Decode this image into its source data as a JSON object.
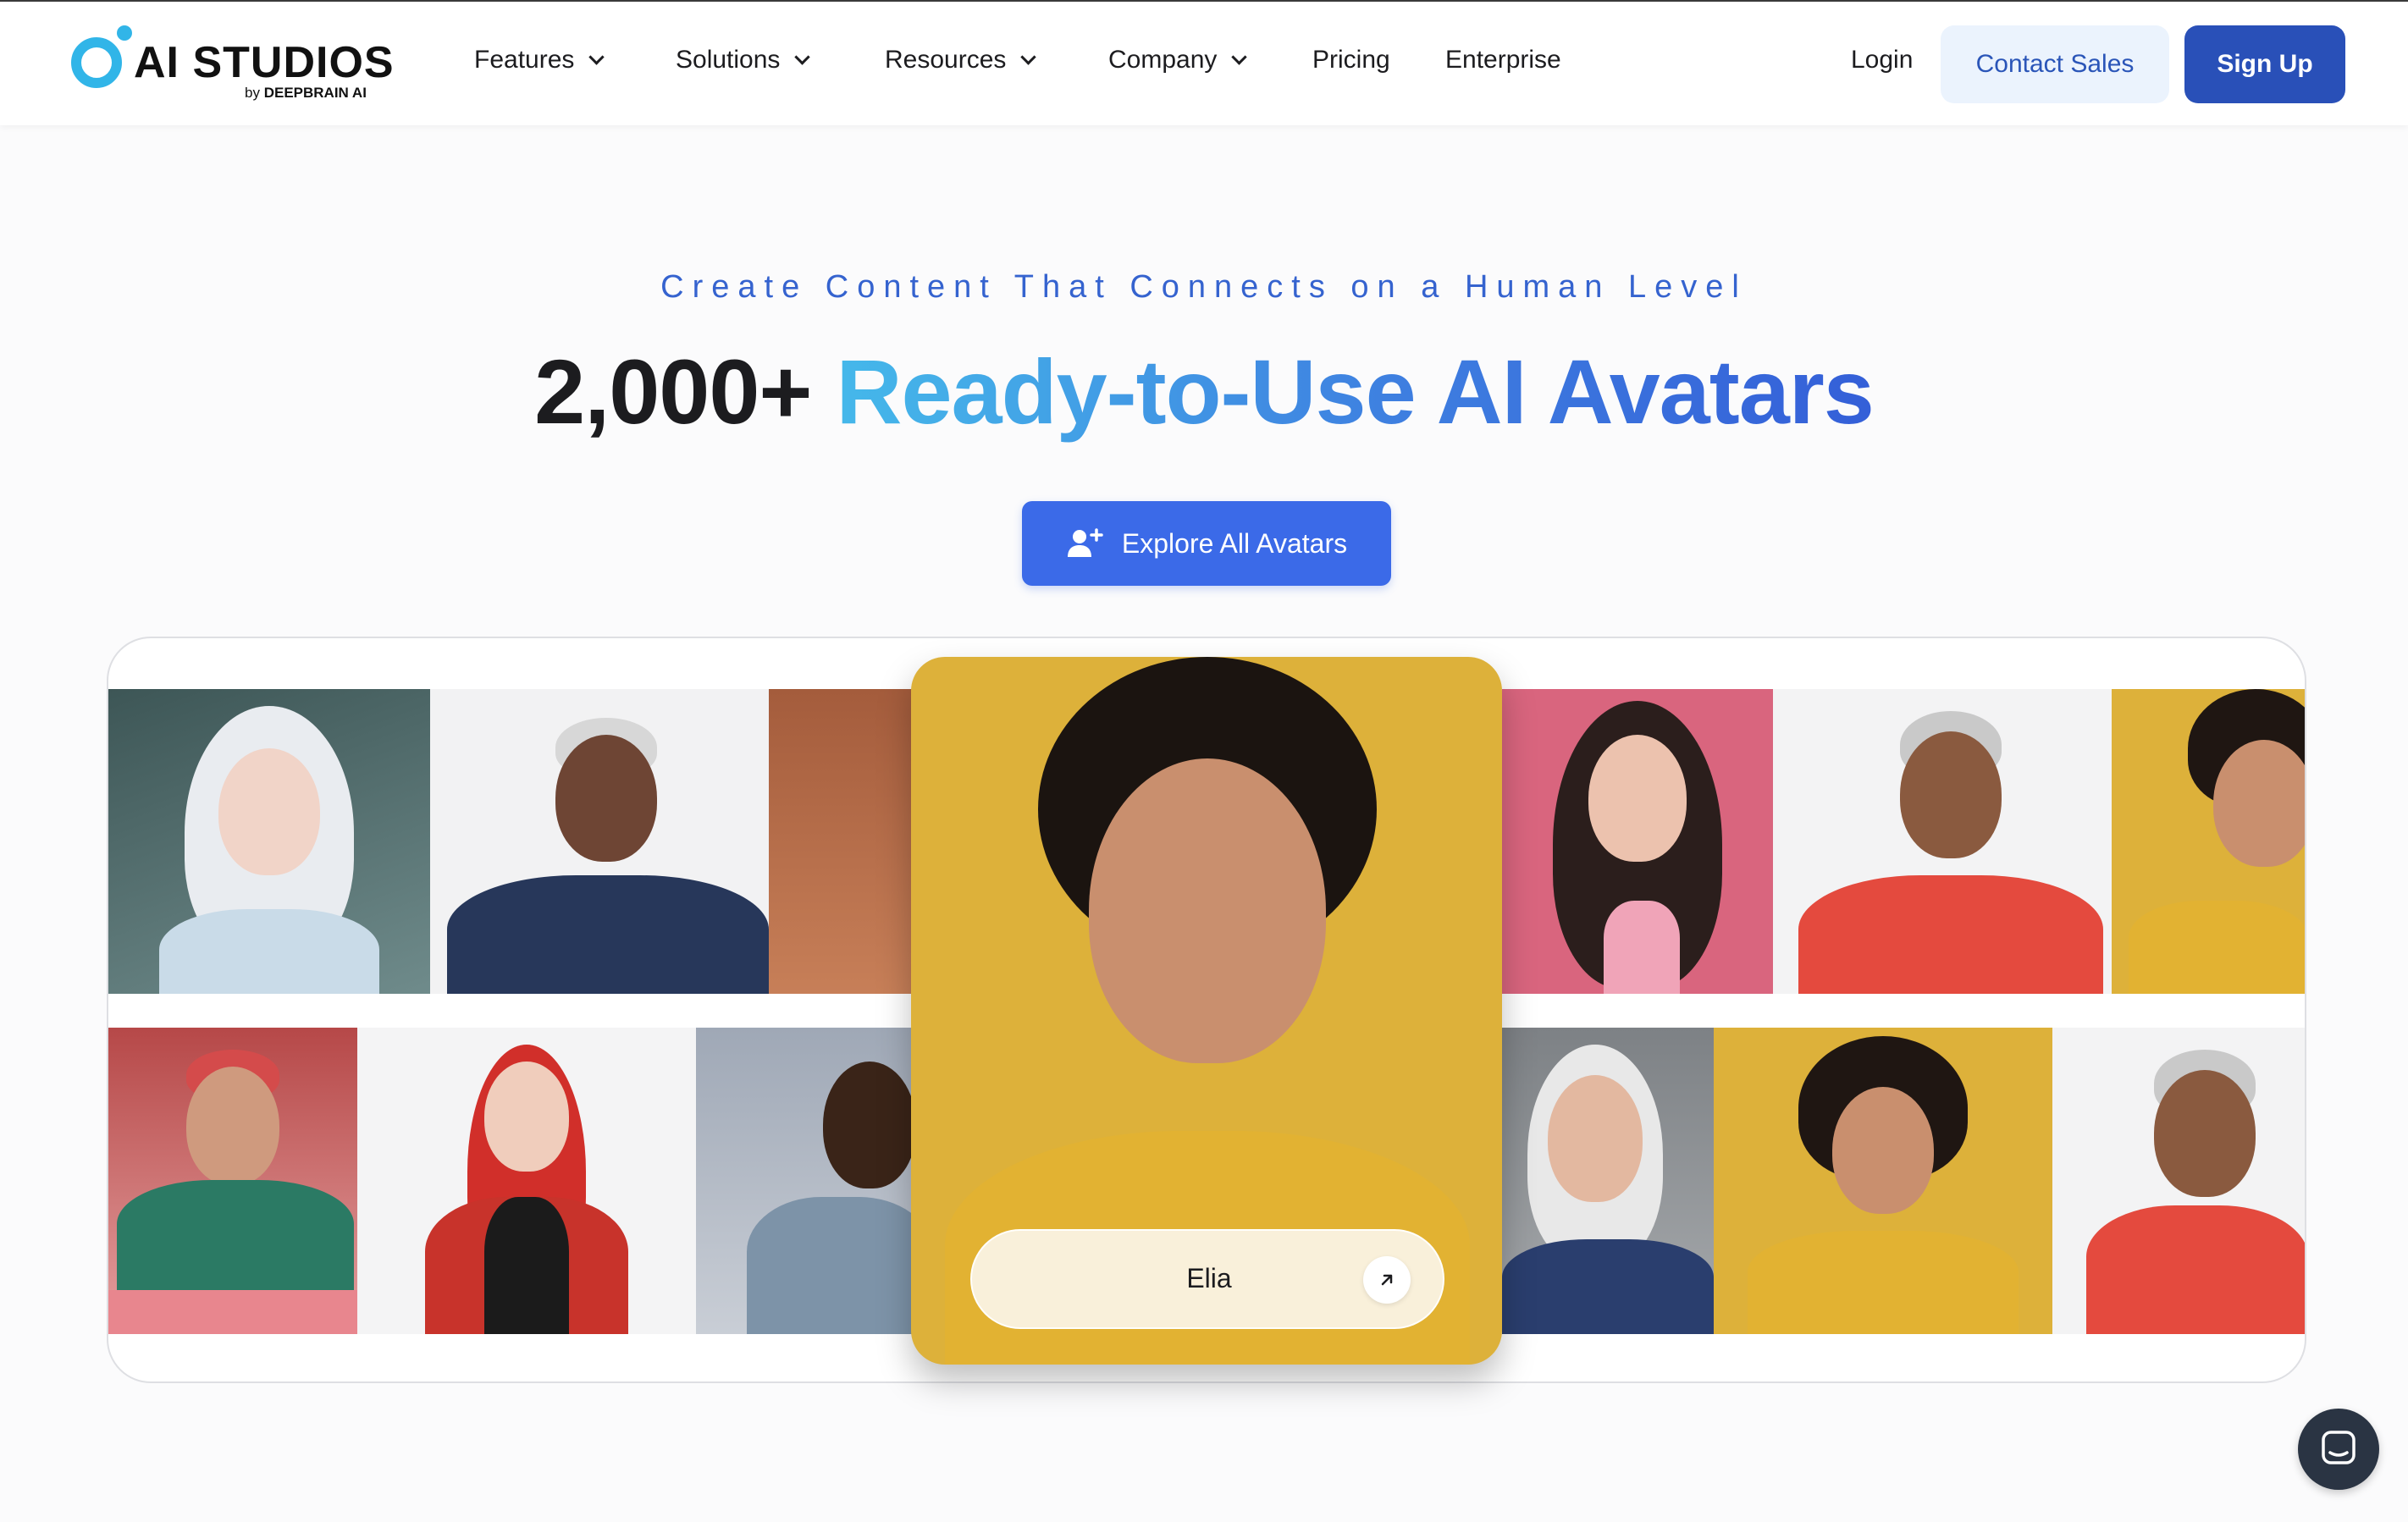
{
  "brand": {
    "name": "AI STUDIOS",
    "by_prefix": "by",
    "by_name": "DEEPBRAIN AI",
    "color": "#31b5e8"
  },
  "nav": {
    "items": [
      {
        "label": "Features",
        "dropdown": true
      },
      {
        "label": "Solutions",
        "dropdown": true
      },
      {
        "label": "Resources",
        "dropdown": true
      },
      {
        "label": "Company",
        "dropdown": true
      },
      {
        "label": "Pricing",
        "dropdown": false
      },
      {
        "label": "Enterprise",
        "dropdown": false
      }
    ],
    "login_label": "Login",
    "contact_label": "Contact Sales",
    "signup_label": "Sign Up"
  },
  "hero": {
    "eyebrow": "Create Content That Connects on a Human Level",
    "headline_number": "2,000+",
    "headline_text": "Ready-to-Use AI Avatars",
    "cta_label": "Explore All Avatars"
  },
  "featured_avatar": {
    "name": "Elia"
  },
  "colors": {
    "primary": "#3b6ae8",
    "signup": "#2950b8",
    "accent_text": "#3563cf"
  }
}
